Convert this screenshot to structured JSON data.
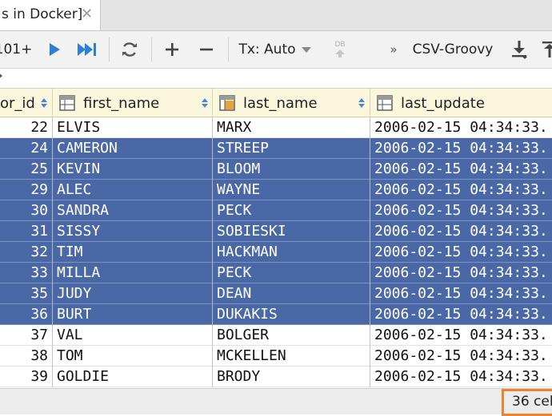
{
  "tab": {
    "label": "s in Docker]"
  },
  "toolbar": {
    "page_size": "101+",
    "tx_mode": "Tx: Auto",
    "db_label": "DB",
    "more": "»",
    "export_format": "CSV-Groovy"
  },
  "grid": {
    "columns": [
      {
        "label": "or_id",
        "icon": "key-column-icon"
      },
      {
        "label": "first_name",
        "icon": "table-column-icon"
      },
      {
        "label": "last_name",
        "icon": "indexed-column-icon"
      },
      {
        "label": "last_update",
        "icon": "table-column-icon"
      }
    ],
    "rows": [
      {
        "id": "22",
        "first_name": "ELVIS",
        "last_name": "MARX",
        "last_update": "2006-02-15 04:34:33.",
        "selected": false
      },
      {
        "id": "24",
        "first_name": "CAMERON",
        "last_name": "STREEP",
        "last_update": "2006-02-15 04:34:33.",
        "selected": true
      },
      {
        "id": "25",
        "first_name": "KEVIN",
        "last_name": "BLOOM",
        "last_update": "2006-02-15 04:34:33.",
        "selected": true
      },
      {
        "id": "29",
        "first_name": "ALEC",
        "last_name": "WAYNE",
        "last_update": "2006-02-15 04:34:33.",
        "selected": true
      },
      {
        "id": "30",
        "first_name": "SANDRA",
        "last_name": "PECK",
        "last_update": "2006-02-15 04:34:33.",
        "selected": true
      },
      {
        "id": "31",
        "first_name": "SISSY",
        "last_name": "SOBIESKI",
        "last_update": "2006-02-15 04:34:33.",
        "selected": true
      },
      {
        "id": "32",
        "first_name": "TIM",
        "last_name": "HACKMAN",
        "last_update": "2006-02-15 04:34:33.",
        "selected": true
      },
      {
        "id": "33",
        "first_name": "MILLA",
        "last_name": "PECK",
        "last_update": "2006-02-15 04:34:33.",
        "selected": true
      },
      {
        "id": "35",
        "first_name": "JUDY",
        "last_name": "DEAN",
        "last_update": "2006-02-15 04:34:33.",
        "selected": true
      },
      {
        "id": "36",
        "first_name": "BURT",
        "last_name": "DUKAKIS",
        "last_update": "2006-02-15 04:34:33.",
        "selected": true
      },
      {
        "id": "37",
        "first_name": "VAL",
        "last_name": "BOLGER",
        "last_update": "2006-02-15 04:34:33.",
        "selected": false
      },
      {
        "id": "38",
        "first_name": "TOM",
        "last_name": "MCKELLEN",
        "last_update": "2006-02-15 04:34:33.",
        "selected": false
      },
      {
        "id": "39",
        "first_name": "GOLDIE",
        "last_name": "BRODY",
        "last_update": "2006-02-15 04:34:33.",
        "selected": false
      }
    ]
  },
  "status": {
    "selection_count": "36 cel"
  },
  "colors": {
    "selection": "#4b68a6",
    "header_bg": "#fbf7dc",
    "accent": "#2d7fd3",
    "highlight_border": "#f0832a"
  }
}
